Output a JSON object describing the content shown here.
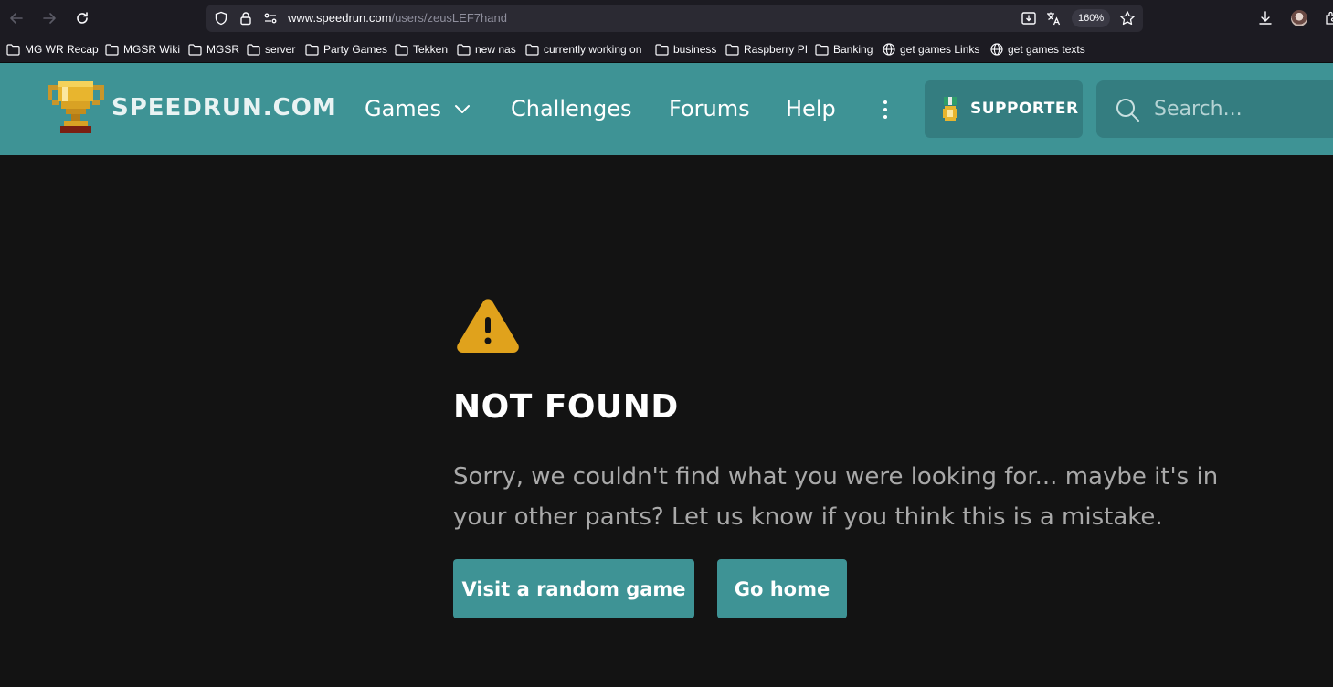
{
  "browser": {
    "url_host": "www.speedrun.com",
    "url_path": "/users/zeusLEF7hand",
    "zoom": "160%",
    "bookmarks": [
      {
        "label": "MG WR Recap",
        "icon": "folder-icon"
      },
      {
        "label": "MGSR Wiki",
        "icon": "folder-icon"
      },
      {
        "label": "MGSR",
        "icon": "folder-icon"
      },
      {
        "label": "server",
        "icon": "folder-icon"
      },
      {
        "label": "Party Games",
        "icon": "folder-icon"
      },
      {
        "label": "Tekken",
        "icon": "folder-icon"
      },
      {
        "label": "new nas",
        "icon": "folder-icon"
      },
      {
        "label": "currently working on",
        "icon": "folder-icon"
      },
      {
        "label": "business",
        "icon": "folder-icon"
      },
      {
        "label": "Raspberry PI",
        "icon": "folder-icon"
      },
      {
        "label": "Banking",
        "icon": "folder-icon"
      },
      {
        "label": "get games Links",
        "icon": "globe-icon"
      },
      {
        "label": "get games texts",
        "icon": "globe-icon"
      }
    ]
  },
  "site": {
    "logo_text": "SPEEDRUN.COM",
    "nav": {
      "games": "Games",
      "challenges": "Challenges",
      "forums": "Forums",
      "help": "Help"
    },
    "supporter_label": "SUPPORTER",
    "search_placeholder": "Search..."
  },
  "main": {
    "title": "NOT FOUND",
    "message": "Sorry, we couldn't find what you were looking for... maybe it's in your other pants? Let us know if you think this is a mistake.",
    "random_game_button": "Visit a random game",
    "home_button": "Go home"
  },
  "colors": {
    "header": "#3e9395",
    "warning": "#e0a21c",
    "background": "#131313"
  }
}
